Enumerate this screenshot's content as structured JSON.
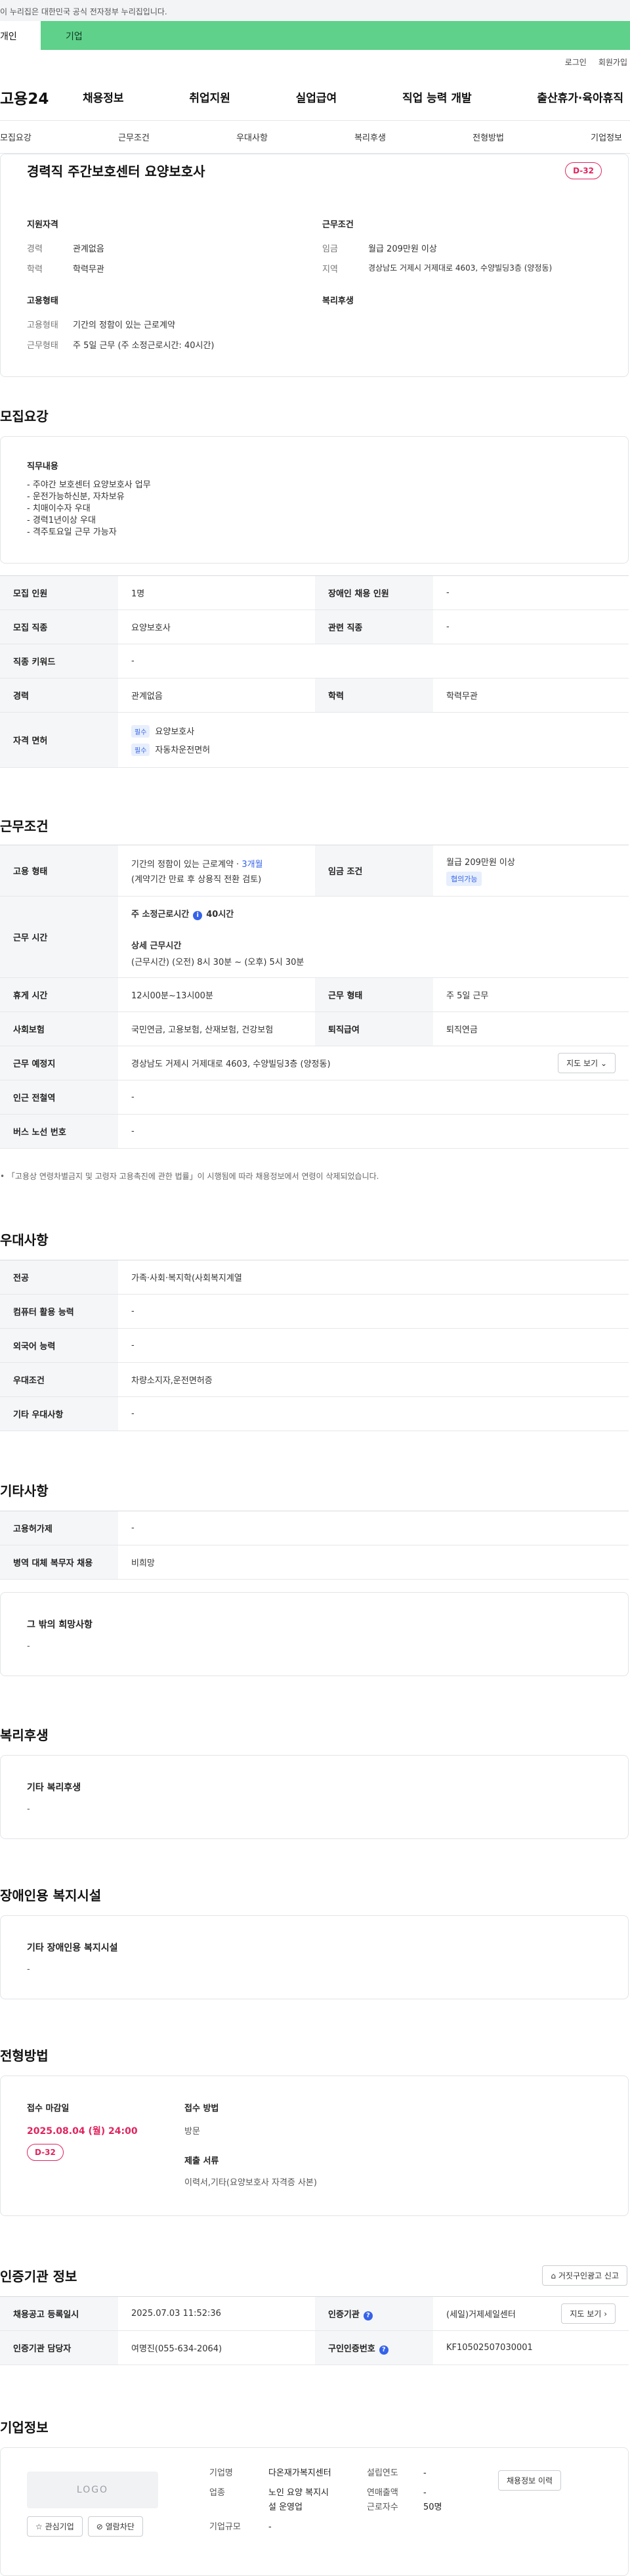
{
  "gov_banner": "이 누리집은 대한민국 공식 전자정부 누리집입니다.",
  "tabs": {
    "personal": "개인",
    "corporate": "기업"
  },
  "util": {
    "login": "로그인",
    "signup": "회원가입"
  },
  "logo": "고용24",
  "gnb": [
    "채용정보",
    "취업지원",
    "실업급여",
    "직업 능력 개발",
    "출산휴가·육아휴직"
  ],
  "subnav": [
    "모집요강",
    "근무조건",
    "우대사항",
    "복리후생",
    "전형방법",
    "기업정보"
  ],
  "summary": {
    "title": "경력직 주간보호센터 요양보호사",
    "dday": "D-32",
    "qual_heading": "지원자격",
    "career_label": "경력",
    "career_value": "관계없음",
    "edu_label": "학력",
    "edu_value": "학력무관",
    "cond_heading": "근무조건",
    "wage_label": "임금",
    "wage_value": "월급 209만원 이상",
    "region_label": "지역",
    "region_value": "경상남도 거제시 거제대로 4603, 수양빌딩3층 (양정동)",
    "emp_heading": "고용형태",
    "emp_type_label": "고용형태",
    "emp_type_value": "기간의 정함이 있는 근로계약",
    "work_form_label": "근무형태",
    "work_form_value": "주 5일 근무 (주 소정근로시간: 40시간)",
    "welfare_heading": "복리후생"
  },
  "recruit": {
    "section_title": "모집요강",
    "duty_heading": "직무내용",
    "duties": [
      "- 주야간 보호센터 요양보호사 업무",
      "- 운전가능하신분, 자차보유",
      "- 치매이수자 우대",
      "- 경력1년이상 우대",
      "- 격주토요일 근무 가능자"
    ],
    "headcount_label": "모집 인원",
    "headcount_value": "1명",
    "disabled_label": "장애인 채용 인원",
    "disabled_value": "-",
    "job_label": "모집 직종",
    "job_value": "요양보호사",
    "related_label": "관련 직종",
    "related_value": "-",
    "keyword_label": "직종 키워드",
    "keyword_value": "-",
    "career_label": "경력",
    "career_value": "관계없음",
    "edu_label": "학력",
    "edu_value": "학력무관",
    "license_label": "자격 면허",
    "req_tag": "필수",
    "licenses": [
      "요양보호사",
      "자동차운전면허"
    ]
  },
  "work": {
    "section_title": "근무조건",
    "emp_label": "고용 형태",
    "emp_value": "기간의 정함이 있는 근로계약 · ",
    "emp_months": "3개월",
    "emp_note": "(계약기간 만료 후 상용직 전환 검토)",
    "wage_label": "임금 조건",
    "wage_value": "월급 209만원 이상",
    "wage_badge": "협의가능",
    "hours_label": "근무 시간",
    "weekly_label": "주 소정근로시간",
    "weekly_value": "40시간",
    "detail_label": "상세 근무시간",
    "detail_value": "(근무시간) (오전) 8시 30분 ~ (오후) 5시 30분",
    "break_label": "휴게 시간",
    "break_value": "12시00분~13시00분",
    "form_label": "근무 형태",
    "form_value": "주 5일 근무",
    "insurance_label": "사회보험",
    "insurance_value": "국민연금, 고용보험, 산재보험, 건강보험",
    "retire_label": "퇴직급여",
    "retire_value": "퇴직연금",
    "place_label": "근무 예정지",
    "place_value": "경상남도 거제시 거제대로 4603, 수양빌딩3층 (양정동)",
    "map_btn": "지도 보기",
    "station_label": "인근 전철역",
    "station_value": "-",
    "bus_label": "버스 노선 번호",
    "bus_value": "-",
    "note": "「고용상 연령차별금지 및 고령자 고용촉진에 관한 법률」이 시행됨에 따라 채용정보에서 연령이 삭제되었습니다."
  },
  "pref": {
    "section_title": "우대사항",
    "major_label": "전공",
    "major_value": "가족·사회·복지학(사회복지계열",
    "computer_label": "컴퓨터 활용 능력",
    "computer_value": "-",
    "lang_label": "외국어 능력",
    "lang_value": "-",
    "cond_label": "우대조건",
    "cond_value": "차량소지자,운전면허증",
    "other_label": "기타 우대사항",
    "other_value": "-"
  },
  "etc": {
    "section_title": "기타사항",
    "hire_label": "고용허가제",
    "hire_value": "-",
    "military_label": "병역 대체 복무자 채용",
    "military_value": "비희망",
    "other_heading": "그 밖의 희망사항",
    "other_value": "-"
  },
  "welfare": {
    "section_title": "복리후생",
    "heading": "기타 복리후생",
    "value": "-"
  },
  "disability": {
    "section_title": "장애인용 복지시설",
    "heading": "기타 장애인용 복지시설",
    "value": "-"
  },
  "screening": {
    "section_title": "전형방법",
    "deadline_label": "접수 마감일",
    "deadline_value": "2025.08.04 (월) 24:00",
    "dday": "D-32",
    "method_label": "접수 방법",
    "method_value": "방문",
    "docs_label": "제출 서류",
    "docs_value": "이력서,기타(요양보호사 자격증 사본)"
  },
  "agency": {
    "section_title": "인증기관 정보",
    "report_btn": "거짓구인광고 신고",
    "reg_label": "채용공고 등록일시",
    "reg_value": "2025.07.03 11:52:36",
    "agency_label": "인증기관",
    "agency_value": "(세일)거제세일센터",
    "map_btn": "지도 보기",
    "manager_label": "인증기관 담당자",
    "manager_value": "여명진(055-634-2064)",
    "number_label": "구인인증번호",
    "number_value": "KF10502507030001"
  },
  "company": {
    "section_title": "기업정보",
    "logo_placeholder": "LOGO",
    "fav_btn": "관심기업",
    "block_btn": "열람차단",
    "name_label": "기업명",
    "name_value": "다온재가복지센터",
    "industry_label": "업종",
    "industry_value_1": "노인 요양 복지시",
    "industry_value_2": "설 운영업",
    "scale_label": "기업규모",
    "scale_value": "-",
    "founded_label": "설립연도",
    "founded_value": "-",
    "sales_label": "연매출액",
    "sales_value": "-",
    "employees_label": "근로자수",
    "employees_value": "50명",
    "history_btn": "채용정보 이력"
  }
}
